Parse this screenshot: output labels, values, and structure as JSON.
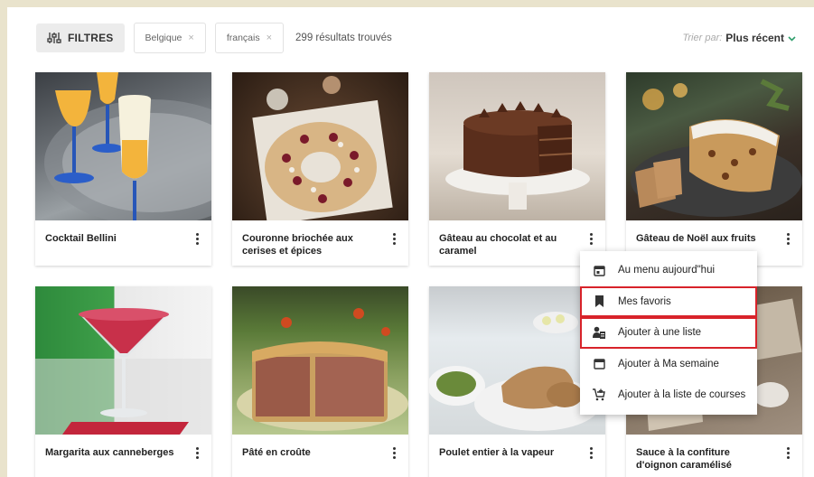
{
  "toolbar": {
    "filter_label": "FILTRES",
    "chips": [
      {
        "label": "Belgique"
      },
      {
        "label": "français"
      }
    ],
    "chip_remove": "×",
    "results_text": "299 résultats trouvés",
    "sort_label": "Trier par:",
    "sort_value": "Plus récent"
  },
  "recipes": [
    {
      "title": "Cocktail Bellini"
    },
    {
      "title": "Couronne briochée aux cerises et épices"
    },
    {
      "title": "Gâteau au chocolat et au caramel"
    },
    {
      "title": "Gâteau de Noël aux fruits"
    },
    {
      "title": "Margarita aux canneberges"
    },
    {
      "title": "Pâté en croûte"
    },
    {
      "title": "Poulet entier à la vapeur"
    },
    {
      "title": "Sauce à la confiture d'oignon caramélisé"
    }
  ],
  "context_menu": {
    "items": [
      {
        "label": "Au menu aujourd\"hui",
        "icon": "calendar-day-icon"
      },
      {
        "label": "Mes favoris",
        "icon": "bookmark-icon",
        "highlighted": true
      },
      {
        "label": "Ajouter à une liste",
        "icon": "add-to-list-icon",
        "highlighted": true
      },
      {
        "label": "Ajouter à Ma semaine",
        "icon": "calendar-icon"
      },
      {
        "label": "Ajouter à la liste de courses",
        "icon": "cart-add-icon"
      }
    ]
  },
  "colors": {
    "accent": "#2f9e6c",
    "highlight_border": "#d8232a"
  }
}
